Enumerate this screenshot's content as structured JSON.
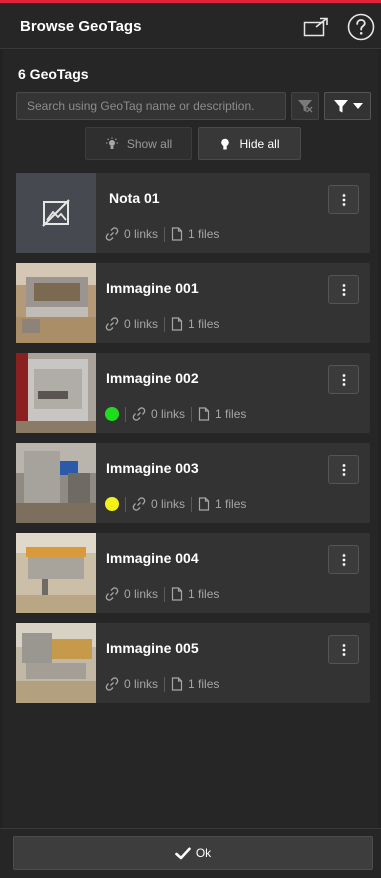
{
  "header": {
    "title": "Browse GeoTags",
    "popout_icon": "popout-window-icon",
    "help_icon": "help-circle-icon"
  },
  "count_label": "6 GeoTags",
  "search": {
    "placeholder": "Search using GeoTag name or description.",
    "value": ""
  },
  "toolbar": {
    "clear_filter_icon": "filter-clear-icon",
    "filter_icon": "filter-icon",
    "show_all_label": "Show all",
    "hide_all_label": "Hide all"
  },
  "colors": {
    "accent_red": "#e0233a",
    "status_green": "#1fdc1f",
    "status_yellow": "#f2f21a"
  },
  "geotags": [
    {
      "name": "Nota 01",
      "type": "note",
      "links": "0 links",
      "files": "1 files"
    },
    {
      "name": "Immagine 001",
      "type": "image",
      "links": "0 links",
      "files": "1 files"
    },
    {
      "name": "Immagine 002",
      "type": "image",
      "status_color": "#1fdc1f",
      "links": "0 links",
      "files": "1 files"
    },
    {
      "name": "Immagine 003",
      "type": "image",
      "status_color": "#f2f21a",
      "links": "0 links",
      "files": "1 files"
    },
    {
      "name": "Immagine 004",
      "type": "image",
      "links": "0 links",
      "files": "1 files"
    },
    {
      "name": "Immagine 005",
      "type": "image",
      "links": "0 links",
      "files": "1 files"
    }
  ],
  "footer": {
    "ok_label": "Ok"
  }
}
